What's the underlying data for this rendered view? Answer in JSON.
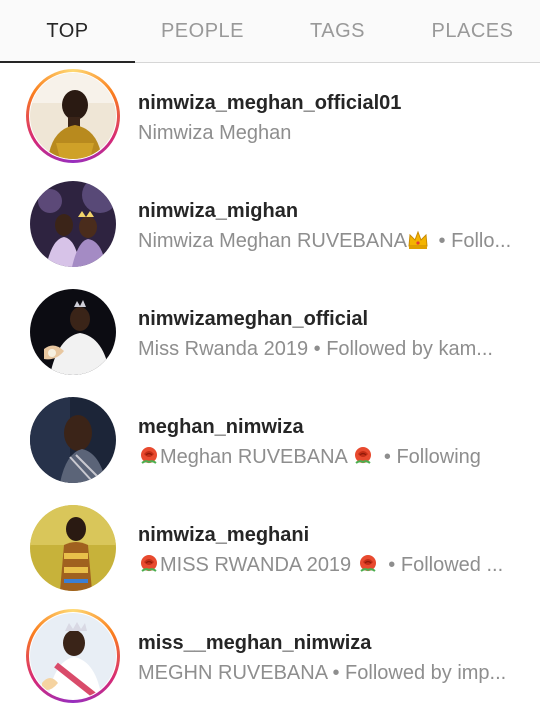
{
  "tabs": [
    {
      "label": "TOP",
      "active": true
    },
    {
      "label": "PEOPLE",
      "active": false
    },
    {
      "label": "TAGS",
      "active": false
    },
    {
      "label": "PLACES",
      "active": false
    }
  ],
  "results": [
    {
      "username": "nimwiza_meghan_official01",
      "subtitle": "Nimwiza Meghan",
      "story_ring": true
    },
    {
      "username": "nimwiza_mighan",
      "subtitle_text": "Nimwiza Meghan RUVEBANA",
      "subtitle_tail": " • Follo...",
      "emoji_after": "crown-icon",
      "story_ring": false
    },
    {
      "username": "nimwizameghan_official",
      "subtitle": "Miss Rwanda 2019 • Followed by kam...",
      "story_ring": false
    },
    {
      "username": "meghan_nimwiza",
      "subtitle_text": "Meghan RUVEBANA",
      "subtitle_tail": " • Following",
      "emoji_around": "rose-icon",
      "story_ring": false
    },
    {
      "username": "nimwiza_meghani",
      "subtitle_text": "MISS RWANDA 2019",
      "subtitle_tail": " • Followed ...",
      "emoji_around": "rose-icon",
      "story_ring": false
    },
    {
      "username": "miss__meghan_nimwiza",
      "subtitle": "MEGHN RUVEBANA • Followed by imp...",
      "story_ring": true
    }
  ],
  "colors": {
    "text": "#262626",
    "secondary": "#8e8e8e",
    "tab_inactive": "#999999",
    "ring_start": "#feda75",
    "ring_end": "#962fbf"
  }
}
